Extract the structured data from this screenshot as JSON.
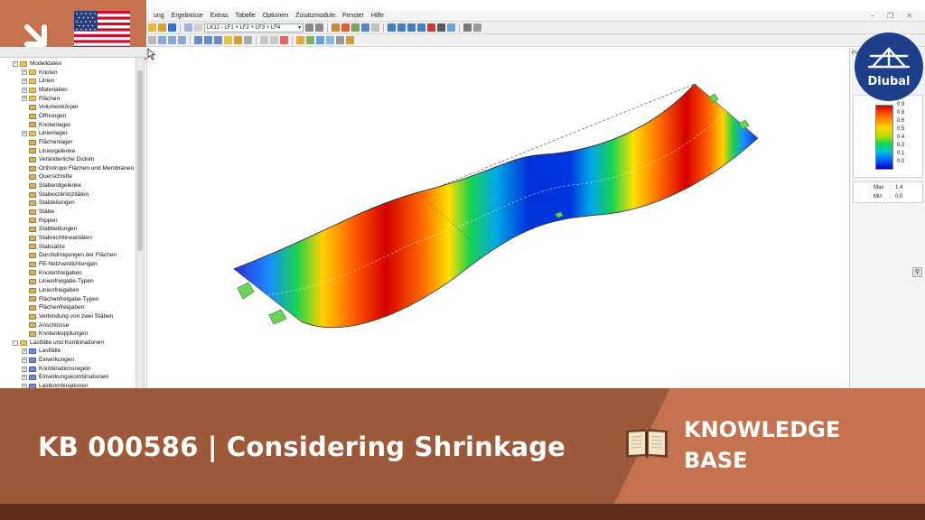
{
  "colors": {
    "banner_dark": "#9d5a3a",
    "banner_light": "#c4724f",
    "bottom_stripe": "#5b2e1f",
    "logo_blue": "#1d3f8a"
  },
  "menu": {
    "items": [
      "ung",
      "Ergebnisse",
      "Extras",
      "Tabelle",
      "Optionen",
      "Zusatzmodule",
      "Fenster",
      "Hilfe"
    ]
  },
  "toolbar": {
    "loadcase_value": "LK12 - LF1 + LF2 + LF3 + LF4"
  },
  "navigator": {
    "items": [
      {
        "label": "Modelldaten",
        "level": 0,
        "expander": "-",
        "icon": "folder-icon"
      },
      {
        "label": "Knoten",
        "level": 1,
        "expander": "+",
        "icon": "folder-icon"
      },
      {
        "label": "Linien",
        "level": 1,
        "expander": "+",
        "icon": "folder-icon"
      },
      {
        "label": "Materialien",
        "level": 1,
        "expander": "+",
        "icon": "folder-icon"
      },
      {
        "label": "Flächen",
        "level": 1,
        "expander": "+",
        "icon": "folder-icon"
      },
      {
        "label": "Volumenkörper",
        "level": 1,
        "expander": "",
        "icon": "item-icon"
      },
      {
        "label": "Öffnungen",
        "level": 1,
        "expander": "",
        "icon": "item-icon"
      },
      {
        "label": "Knotenlager",
        "level": 1,
        "expander": "",
        "icon": "item-icon"
      },
      {
        "label": "Linienlager",
        "level": 1,
        "expander": "+",
        "icon": "folder-icon"
      },
      {
        "label": "Flächenlager",
        "level": 1,
        "expander": "",
        "icon": "item-icon"
      },
      {
        "label": "Liniengelenke",
        "level": 1,
        "expander": "",
        "icon": "item-icon"
      },
      {
        "label": "Veränderliche Dicken",
        "level": 1,
        "expander": "",
        "icon": "item-icon"
      },
      {
        "label": "Orthotrope Flächen und Membranen",
        "level": 1,
        "expander": "",
        "icon": "item-icon"
      },
      {
        "label": "Querschnitte",
        "level": 1,
        "expander": "",
        "icon": "item-icon"
      },
      {
        "label": "Stabendgelenke",
        "level": 1,
        "expander": "",
        "icon": "item-icon"
      },
      {
        "label": "Stabexzentrizitäten",
        "level": 1,
        "expander": "",
        "icon": "item-icon"
      },
      {
        "label": "Stabteilungen",
        "level": 1,
        "expander": "",
        "icon": "item-icon"
      },
      {
        "label": "Stäbe",
        "level": 1,
        "expander": "",
        "icon": "item-icon"
      },
      {
        "label": "Rippen",
        "level": 1,
        "expander": "",
        "icon": "item-icon"
      },
      {
        "label": "Stabbettungen",
        "level": 1,
        "expander": "",
        "icon": "item-icon"
      },
      {
        "label": "Stabnichtlinearitäten",
        "level": 1,
        "expander": "",
        "icon": "item-icon"
      },
      {
        "label": "Stabsätze",
        "level": 1,
        "expander": "",
        "icon": "item-icon"
      },
      {
        "label": "Durchdringungen der Flächen",
        "level": 1,
        "expander": "",
        "icon": "item-icon"
      },
      {
        "label": "FE-Netzverdichtungen",
        "level": 1,
        "expander": "",
        "icon": "item-icon"
      },
      {
        "label": "Knotenfreigaben",
        "level": 1,
        "expander": "",
        "icon": "item-icon"
      },
      {
        "label": "Linienfreigabe-Typen",
        "level": 1,
        "expander": "",
        "icon": "item-icon"
      },
      {
        "label": "Linienfreigaben",
        "level": 1,
        "expander": "",
        "icon": "item-icon"
      },
      {
        "label": "Flächenfreigabe-Typen",
        "level": 1,
        "expander": "",
        "icon": "item-icon"
      },
      {
        "label": "Flächenfreigaben",
        "level": 1,
        "expander": "",
        "icon": "item-icon"
      },
      {
        "label": "Verbindung von zwei Stäben",
        "level": 1,
        "expander": "",
        "icon": "item-icon"
      },
      {
        "label": "Anschlüsse",
        "level": 1,
        "expander": "",
        "icon": "item-icon"
      },
      {
        "label": "Knotenkopplungen",
        "level": 1,
        "expander": "",
        "icon": "item-icon"
      },
      {
        "label": "Lastfälle und Kombinationen",
        "level": 0,
        "expander": "-",
        "icon": "folder-icon"
      },
      {
        "label": "Lastfälle",
        "level": 1,
        "expander": "+",
        "icon": "blue-icon"
      },
      {
        "label": "Einwirkungen",
        "level": 1,
        "expander": "+",
        "icon": "blue-icon"
      },
      {
        "label": "Kombinationsregeln",
        "level": 1,
        "expander": "+",
        "icon": "blue-icon"
      },
      {
        "label": "Einwirkungskombinationen",
        "level": 1,
        "expander": "+",
        "icon": "blue-icon"
      },
      {
        "label": "Lastkombinationen",
        "level": 1,
        "expander": "+",
        "icon": "blue-icon"
      }
    ]
  },
  "right_panel": {
    "header": "Par",
    "legend_ticks": [
      "0.9",
      "0.8",
      "0.6",
      "0.5",
      "0.4",
      "0.3",
      "0.1",
      "0.0"
    ],
    "max_label": "Max",
    "max_value": "1.4",
    "min_label": "Min",
    "min_value": "0.0"
  },
  "logo": {
    "text": "Dlubal"
  },
  "banner": {
    "title": "KB 000586 | Considering Shrinkage",
    "kb_line1": "KNOWLEDGE",
    "kb_line2": "BASE"
  }
}
